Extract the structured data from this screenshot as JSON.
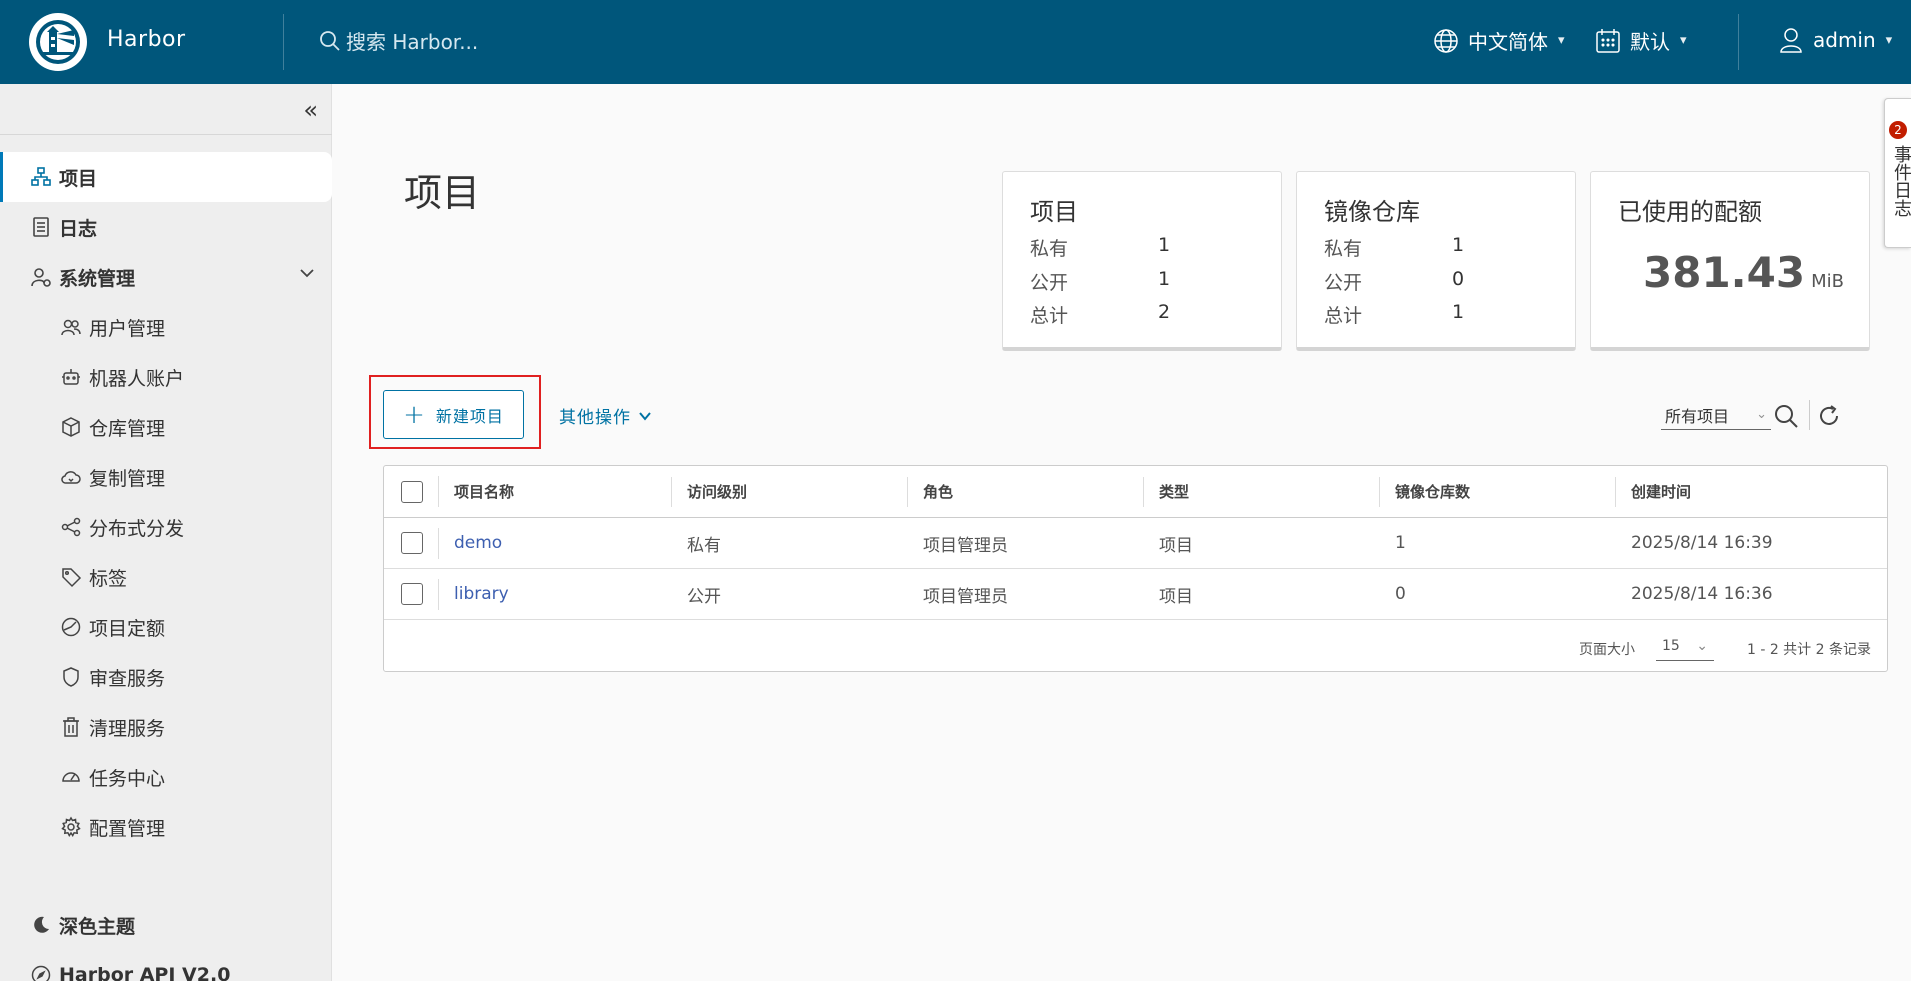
{
  "header": {
    "brand": "Harbor",
    "search_placeholder": "搜索 Harbor...",
    "language": "中文简体",
    "datetime_format": "默认",
    "user": "admin"
  },
  "sidebar": {
    "items": [
      {
        "label": "项目",
        "icon": "project-icon",
        "active": true
      },
      {
        "label": "日志",
        "icon": "log-icon"
      },
      {
        "label": "系统管理",
        "icon": "admin-icon"
      },
      {
        "label": "用户管理",
        "icon": "users-icon"
      },
      {
        "label": "机器人账户",
        "icon": "robot-icon"
      },
      {
        "label": "仓库管理",
        "icon": "registry-icon"
      },
      {
        "label": "复制管理",
        "icon": "cloud-sync-icon"
      },
      {
        "label": "分布式分发",
        "icon": "share-icon"
      },
      {
        "label": "标签",
        "icon": "tag-icon"
      },
      {
        "label": "项目定额",
        "icon": "quota-icon"
      },
      {
        "label": "审查服务",
        "icon": "shield-icon"
      },
      {
        "label": "清理服务",
        "icon": "trash-icon"
      },
      {
        "label": "任务中心",
        "icon": "dashboard-icon"
      },
      {
        "label": "配置管理",
        "icon": "gear-icon"
      }
    ],
    "dark_theme": "深色主题",
    "api": "Harbor API V2.0"
  },
  "main": {
    "title": "项目",
    "cards": {
      "projects": {
        "title": "项目",
        "private_label": "私有",
        "private": "1",
        "public_label": "公开",
        "public": "1",
        "total_label": "总计",
        "total": "2"
      },
      "repos": {
        "title": "镜像仓库",
        "private_label": "私有",
        "private": "1",
        "public_label": "公开",
        "public": "0",
        "total_label": "总计",
        "total": "1"
      },
      "quota": {
        "title": "已使用的配额",
        "value": "381.43",
        "unit": "MiB"
      }
    },
    "toolbar": {
      "new_project": "新建项目",
      "more_actions": "其他操作",
      "filter": "所有项目"
    },
    "table": {
      "columns": [
        "项目名称",
        "访问级别",
        "角色",
        "类型",
        "镜像仓库数",
        "创建时间"
      ],
      "rows": [
        {
          "name": "demo",
          "access": "私有",
          "role": "项目管理员",
          "type": "项目",
          "repos": "1",
          "created": "2025/8/14 16:39"
        },
        {
          "name": "library",
          "access": "公开",
          "role": "项目管理员",
          "type": "项目",
          "repos": "0",
          "created": "2025/8/14 16:36"
        }
      ],
      "page_size_label": "页面大小",
      "page_size": "15",
      "page_info": "1 - 2 共计 2 条记录"
    }
  },
  "event_log": {
    "label": "事件日志",
    "count": "2"
  },
  "colors": {
    "header": "#00567b",
    "accent": "#0072a3",
    "badge": "#c21d00"
  }
}
